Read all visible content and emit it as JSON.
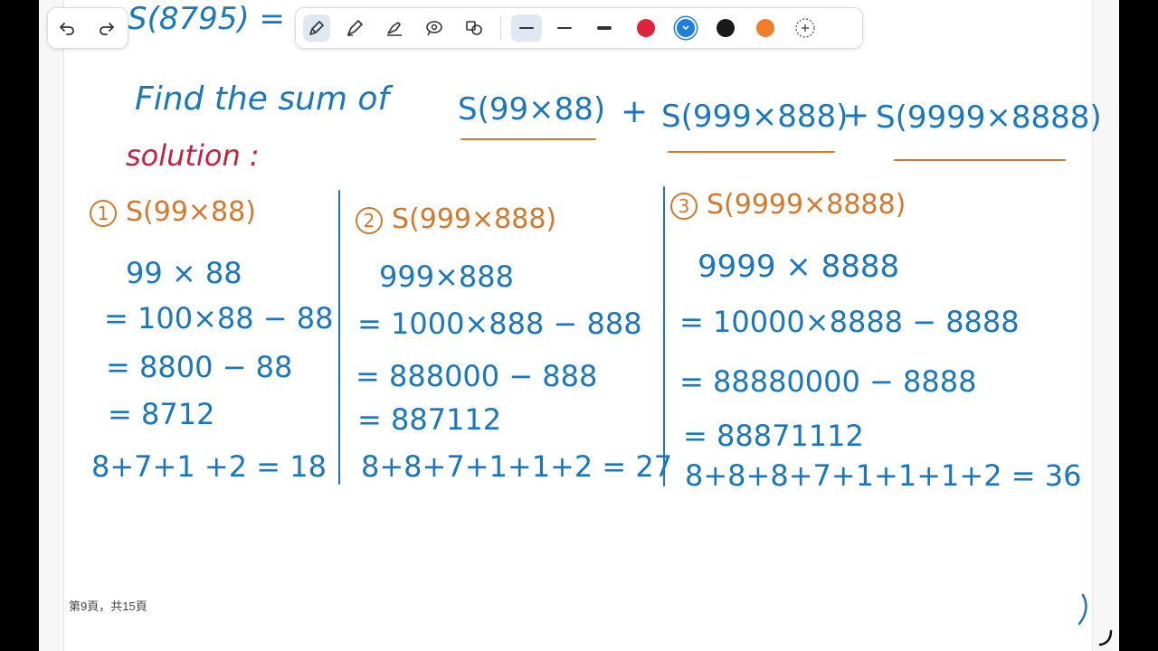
{
  "toolbar": {
    "undo_icon": "undo-icon",
    "redo_icon": "redo-icon",
    "tools": [
      "pen-icon",
      "pencil-icon",
      "highlighter-icon",
      "lasso-icon",
      "shapes-icon"
    ],
    "colors": {
      "red": "#e0223a",
      "blue": "#1e7fe0",
      "black": "#1a1a1a",
      "orange": "#ef7d2a"
    },
    "selected_color": "blue",
    "add_color_icon": "add-color-icon"
  },
  "notes": {
    "top_partial": "S(8795) = ...",
    "title_prefix": "Find the sum of",
    "term1": "S(99×88)",
    "plus": "+",
    "term2": "S(999×888)",
    "term3": "S(9999×8888)",
    "solution_label": "solution :",
    "col1": {
      "num": "1",
      "head": "S(99×88)",
      "lines": [
        "99 × 88",
        "= 100×88 − 88",
        "= 8800 − 88",
        "= 8712"
      ],
      "digit_sum": "8+7+1 +2 = 18"
    },
    "col2": {
      "num": "2",
      "head": "S(999×888)",
      "lines": [
        "999×888",
        "= 1000×888 − 888",
        "= 888000 − 888",
        "= 887112"
      ],
      "digit_sum": "8+8+7+1+1+2 = 27"
    },
    "col3": {
      "num": "3",
      "head": "S(9999×8888)",
      "lines": [
        "9999 × 8888",
        "= 10000×8888 − 8888",
        "= 88880000 − 8888",
        "= 88871112"
      ],
      "digit_sum": "8+8+8+7+1+1+1+2 = 36"
    }
  },
  "page_indicator": "第9頁，共15頁"
}
